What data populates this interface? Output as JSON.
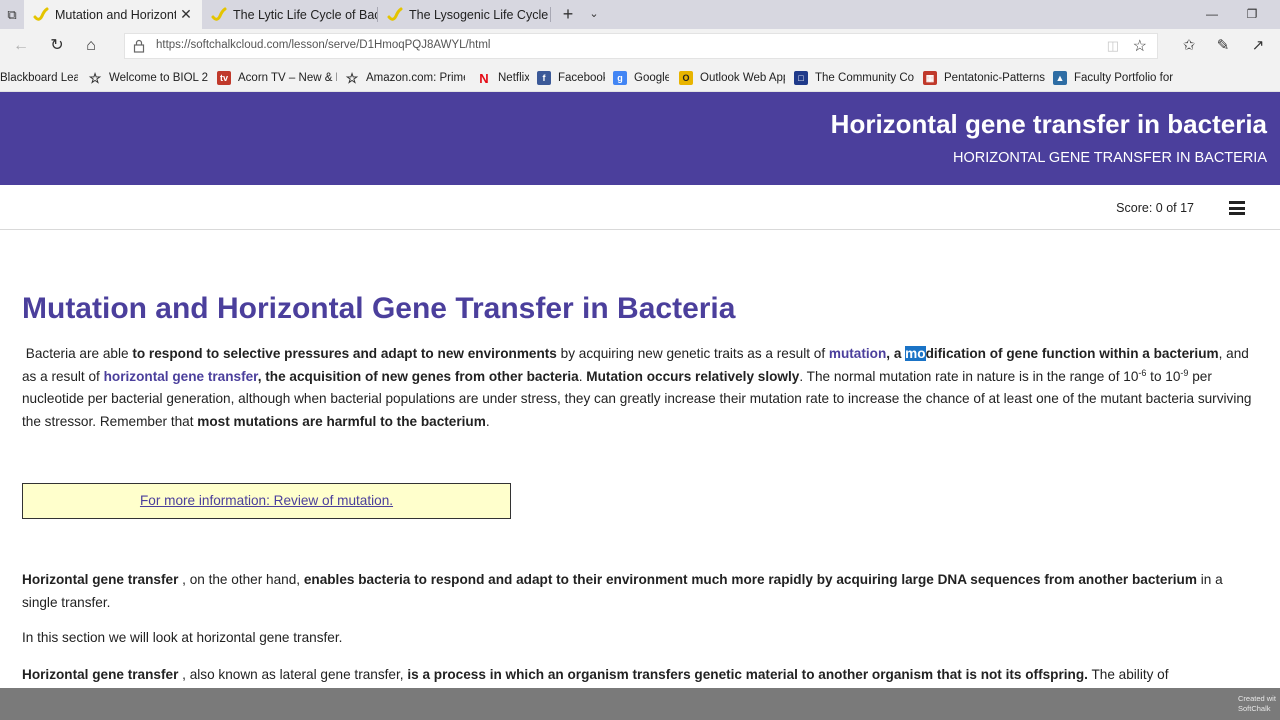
{
  "browser": {
    "tabs": [
      {
        "label": "Mutation and Horizonta",
        "active": true
      },
      {
        "label": "The Lytic Life Cycle of Bacte",
        "active": false
      },
      {
        "label": "The Lysogenic Life Cycle of",
        "active": false
      }
    ],
    "tab_close_symbol": "✕",
    "new_tab_symbol": "+",
    "url": "https://softchalkcloud.com/lesson/serve/D1HmoqPQJ8AWYL/html",
    "favorites": [
      {
        "label": "Blackboard Learn",
        "icon": "blackboard-icon",
        "color": "#444444"
      },
      {
        "label": "Welcome to BIOL 230",
        "icon": "star-outline-icon",
        "color": "#333333"
      },
      {
        "label": "Acorn TV – New & Fe",
        "icon": "acorn-tv-icon",
        "color": "#c0392b"
      },
      {
        "label": "Amazon.com: Prime I",
        "icon": "star-outline-icon",
        "color": "#333333"
      },
      {
        "label": "Netflix",
        "icon": "netflix-icon",
        "color": "#e50914"
      },
      {
        "label": "Facebook",
        "icon": "facebook-icon",
        "color": "#3b5998"
      },
      {
        "label": "Google",
        "icon": "google-icon",
        "color": "#4285f4"
      },
      {
        "label": "Outlook Web App",
        "icon": "outlook-icon",
        "color": "#e8b400"
      },
      {
        "label": "The Community Colle",
        "icon": "community-college-icon",
        "color": "#1f3a8a"
      },
      {
        "label": "Pentatonic-Patterns-f",
        "icon": "pdf-icon",
        "color": "#c0392b"
      },
      {
        "label": "Faculty Portfolio for C",
        "icon": "faculty-portfolio-icon",
        "color": "#2e6da4"
      }
    ]
  },
  "lesson": {
    "banner_title": "Horizontal gene transfer in bacteria",
    "banner_subtitle": "HORIZONTAL GENE TRANSFER IN BACTERIA",
    "score": "Score: 0 of 17",
    "heading": "Mutation and Horizontal Gene Transfer in Bacteria",
    "p1": {
      "t1": "Bacteria are able ",
      "b1": "to respond to selective pressures and adapt to new environments",
      "t2": " by acquiring new genetic traits as a result of ",
      "link1": "mutation",
      "b2a": ", a ",
      "b2hl": "mo",
      "b2b": "dification of gene function within a bacterium",
      "t3": ", and as a result of ",
      "link2": "horizontal gene transfer",
      "b3": ", the acquisition of new genes from other bacteria",
      "t4": ". ",
      "b4": "Mutation occurs relatively slowly",
      "t5": ". The normal mutation rate in nature is in the range of 10",
      "sup1": "-6",
      "t6": " to 10",
      "sup2": "-9",
      "t7": " per nucleotide per bacterial generation, although when bacterial populations are under stress, they can greatly increase their mutation rate to increase the chance of at least one of the mutant bacteria surviving the stressor. Remember that ",
      "b5": "most mutations are harmful to the bacterium",
      "t8": "."
    },
    "info_link": "For more information: Review of mutation.",
    "p2": {
      "b1": "Horizontal gene transfer",
      "t1": " , on the other hand, ",
      "b2": "enables bacteria to respond and adapt to their environment much more rapidly by acquiring large DNA sequences from another bacterium",
      "t2": " in a single transfer."
    },
    "p3": "In this section we will look at horizontal gene transfer.",
    "p4": {
      "b1": "Horizontal gene transfer",
      "t1": " , also known as lateral gene transfer, ",
      "b2": "is a process in which an organism transfers genetic material to another organism that is not its offspring.",
      "t2": " The ability of"
    },
    "footer_credit_line1": "Created wit",
    "footer_credit_line2": "SoftChalk"
  },
  "colors": {
    "brand_purple": "#4b3f9c",
    "info_box_yellow": "#ffffcc",
    "selection_blue": "#1a73c6"
  }
}
